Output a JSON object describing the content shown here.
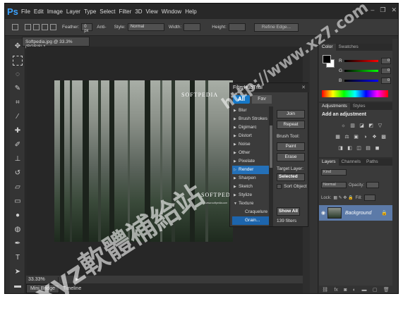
{
  "app": {
    "logo": "Ps"
  },
  "menu": [
    "File",
    "Edit",
    "Image",
    "Layer",
    "Type",
    "Select",
    "Filter",
    "3D",
    "View",
    "Window",
    "Help"
  ],
  "window_controls": [
    "–",
    "❐",
    "✕"
  ],
  "options": {
    "feather_label": "Feather:",
    "feather_value": "0 px",
    "antialias_label": "Anti-",
    "style_label": "Style:",
    "style_value": "Normal",
    "width_label": "Width:",
    "height_label": "Height:",
    "refine_label": "Refine Edge..."
  },
  "tools": [
    "move-tool",
    "marquee-tool",
    "lasso-tool",
    "quick-select-tool",
    "crop-tool",
    "eyedropper-tool",
    "healing-tool",
    "brush-tool",
    "stamp-tool",
    "history-brush-tool",
    "eraser-tool",
    "gradient-tool",
    "blur-tool",
    "dodge-tool",
    "pen-tool",
    "type-tool",
    "path-select-tool",
    "shape-tool",
    "hand-tool",
    "zoom-tool"
  ],
  "document": {
    "tab_label": "Softpedia.jpg @ 33.3% (RGB/8) *",
    "zoom": "33.33%",
    "watermark_top": "SOFTPEDIA",
    "watermark_bottom": "SOFTPEDIA",
    "watermark_url": "www.softpedia.com"
  },
  "bottom_tabs": [
    "Mini Bridge",
    "Timeline"
  ],
  "filterhub": {
    "title": "FilterHubTrial",
    "close": "✕",
    "tab_all": "All",
    "tab_fav": "Fav",
    "filters": [
      {
        "label": "Blur",
        "arrow": "▶",
        "state": "normal"
      },
      {
        "label": "Brush Strokes",
        "arrow": "▶",
        "state": "normal"
      },
      {
        "label": "Digimarc",
        "arrow": "▶",
        "state": "normal"
      },
      {
        "label": "Distort",
        "arrow": "▶",
        "state": "normal"
      },
      {
        "label": "Noise",
        "arrow": "▶",
        "state": "normal"
      },
      {
        "label": "Other",
        "arrow": "▶",
        "state": "normal"
      },
      {
        "label": "Pixelate",
        "arrow": "▶",
        "state": "normal"
      },
      {
        "label": "Render",
        "arrow": "▷",
        "state": "selected"
      },
      {
        "label": "Sharpen",
        "arrow": "▶",
        "state": "normal"
      },
      {
        "label": "Sketch",
        "arrow": "▶",
        "state": "normal"
      },
      {
        "label": "Stylize",
        "arrow": "▶",
        "state": "normal"
      },
      {
        "label": "Texture",
        "arrow": "▼",
        "state": "normal"
      },
      {
        "label": "Craquelure",
        "arrow": "",
        "state": "sub"
      },
      {
        "label": "Grain...",
        "arrow": "",
        "state": "subsel"
      }
    ],
    "join": "Join",
    "repeat": "Repeat",
    "brush_tool": "Brush Tool:",
    "paint": "Paint",
    "erase": "Erase",
    "target_layer": "Target Layer:",
    "selected": "Selected",
    "sort_object": "Sort Object",
    "show_all": "Show All",
    "count": "139 filters"
  },
  "color_panel": {
    "tabs": [
      "Color",
      "Swatches"
    ],
    "r": "0",
    "g": "0",
    "b": "0",
    "r_label": "R",
    "g_label": "G",
    "b_label": "B"
  },
  "adjustments": {
    "tabs": [
      "Adjustments",
      "Styles"
    ],
    "title": "Add an adjustment",
    "row1": [
      "☼",
      "▥",
      "◪",
      "◩",
      "▽"
    ],
    "row2": [
      "▦",
      "⚖",
      "▣",
      "◑",
      "❖",
      "▩"
    ],
    "row3": [
      "◨",
      "◧",
      "◫",
      "▤",
      "◼"
    ]
  },
  "layers": {
    "tabs": [
      "Layers",
      "Channels",
      "Paths"
    ],
    "kind": "Kind",
    "blend": "Normal",
    "opacity_label": "Opacity:",
    "lock_label": "Lock:",
    "fill_label": "Fill:",
    "layer_name": "Background",
    "footer": [
      "⛓",
      "fx",
      "◙",
      "◐",
      "▬",
      "▢",
      "🗑"
    ]
  },
  "overlay": {
    "diagonal_top": "http://www.xz7.com",
    "diagonal_bottom": "xyz軟體補給站"
  }
}
